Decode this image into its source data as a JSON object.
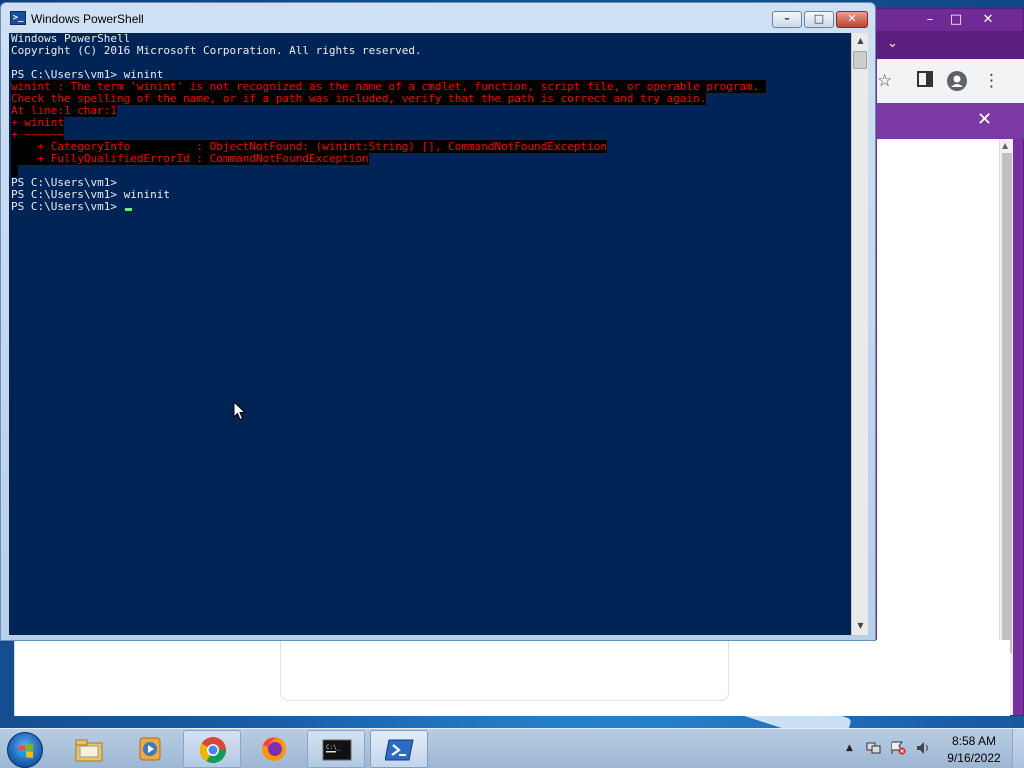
{
  "powershell": {
    "title": "Windows PowerShell",
    "lines": [
      {
        "text": "Windows PowerShell",
        "error": false
      },
      {
        "text": "Copyright (C) 2016 Microsoft Corporation. All rights reserved.",
        "error": false
      },
      {
        "text": "",
        "error": false
      },
      {
        "text": "PS C:\\Users\\vm1> winint",
        "error": false
      },
      {
        "text": "winint : The term 'winint' is not recognized as the name of a cmdlet, function, script file, or operable program. ",
        "error": true
      },
      {
        "text": "Check the spelling of the name, or if a path was included, verify that the path is correct and try again.",
        "error": true
      },
      {
        "text": "At line:1 char:1",
        "error": true
      },
      {
        "text": "+ winint",
        "error": true
      },
      {
        "text": "+ ~~~~~~",
        "error": true
      },
      {
        "text": "    + CategoryInfo          : ObjectNotFound: (winint:String) [], CommandNotFoundException",
        "error": true
      },
      {
        "text": "    + FullyQualifiedErrorId : CommandNotFoundException",
        "error": true
      },
      {
        "text": " ",
        "error": true
      },
      {
        "text": "PS C:\\Users\\vm1>",
        "error": false
      },
      {
        "text": "PS C:\\Users\\vm1> wininit",
        "error": false
      },
      {
        "text": "PS C:\\Users\\vm1> ",
        "error": false,
        "cursor": true
      }
    ],
    "colors": {
      "background": "#012456",
      "foreground": "#eeedf0",
      "error_fg": "#ff0000",
      "error_bg": "#000000"
    }
  },
  "taskbar": {
    "items": [
      {
        "name": "windows-explorer",
        "icon": "folder-icon"
      },
      {
        "name": "windows-media-player",
        "icon": "media-player-icon"
      },
      {
        "name": "google-chrome",
        "icon": "chrome-icon"
      },
      {
        "name": "firefox",
        "icon": "firefox-icon"
      },
      {
        "name": "command-prompt",
        "icon": "cmd-icon"
      },
      {
        "name": "powershell",
        "icon": "powershell-icon"
      }
    ],
    "clock": {
      "time": "8:58 AM",
      "date": "9/16/2022"
    }
  },
  "browser": {
    "icons": [
      "star-icon",
      "sidebar-icon",
      "profile-icon",
      "menu-icon",
      "close-icon"
    ]
  }
}
